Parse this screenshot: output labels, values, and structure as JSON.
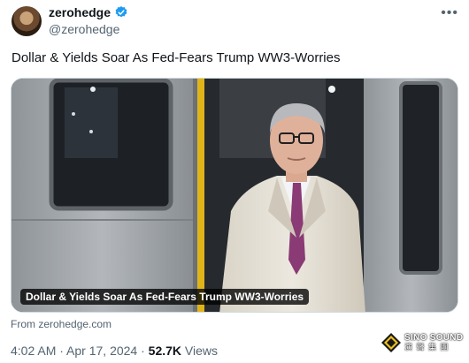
{
  "author": {
    "display_name": "zerohedge",
    "handle": "@zerohedge",
    "verified_color": "#1d9bf0"
  },
  "more_icon": "more-horizontal-icon",
  "tweet_text": "Dollar & Yields Soar As Fed-Fears Trump WW3-Worries",
  "card": {
    "caption": "Dollar & Yields Soar As Fed-Fears Trump WW3-Worries",
    "source": "From zerohedge.com"
  },
  "meta": {
    "time": "4:02 AM",
    "sep": " · ",
    "date": "Apr 17, 2024",
    "views_count": "52.7K",
    "views_label": "Views"
  },
  "watermark": {
    "brand": "SINO SOUND",
    "subtitle": "演 聲 集 團"
  }
}
